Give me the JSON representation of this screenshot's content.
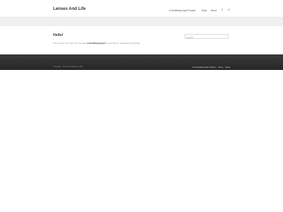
{
  "header": {
    "site_title": "Lenses And Life",
    "nav": {
      "items": [
        {
          "label": "A Something Apart Project"
        },
        {
          "label": "Shop"
        },
        {
          "label": "About"
        }
      ],
      "icons": [
        "search-icon",
        "cart-icon"
      ]
    }
  },
  "main": {
    "title": "Hello!",
    "text_before_link": "You must be new here now you have ",
    "link_text": "a Something Apart",
    "text_after_link": " so you want to understand everything.",
    "search": {
      "placeholder": "Search"
    }
  },
  "footer": {
    "copyright": "Copyright · Powered Theme by Me!",
    "nav": {
      "items": [
        {
          "label": "A Something Apart Project"
        },
        {
          "label": "Shop"
        },
        {
          "label": "About"
        }
      ]
    }
  }
}
